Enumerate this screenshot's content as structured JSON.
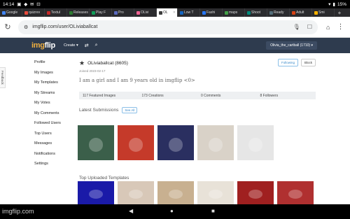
{
  "status": {
    "time": "14:14",
    "icons": "▣ ◆ ✉ ⊡",
    "battery": "15%"
  },
  "tabs": [
    {
      "label": "Google",
      "color": "#4285f4"
    },
    {
      "label": "quizrev",
      "color": "#e84b3c"
    },
    {
      "label": "Textul",
      "color": "#c62828"
    },
    {
      "label": "Releases",
      "color": "#2e7d32"
    },
    {
      "label": "Play F",
      "color": "#0f9d58"
    },
    {
      "label": "Pro",
      "color": "#5c6bc0"
    },
    {
      "label": "OLivi",
      "color": "#f06292"
    },
    {
      "label": "OL",
      "color": "#3d3d3d",
      "active": true
    },
    {
      "label": "Low T",
      "color": "#1565c0"
    },
    {
      "label": "Fashi",
      "color": "#2979ff"
    },
    {
      "label": "maps",
      "color": "#43a047"
    },
    {
      "label": "Shoot",
      "color": "#00897b"
    },
    {
      "label": "Ready",
      "color": "#546e7a"
    },
    {
      "label": "Adult",
      "color": "#d84315"
    },
    {
      "label": "Smi",
      "color": "#ffb300"
    }
  ],
  "address": {
    "url": "imgflip.com/user/OLiviaballcat"
  },
  "header": {
    "logo_a": "img",
    "logo_b": "flip",
    "create": "Create ▾",
    "username_btn": "Olivia_the_cartball (1710) ▾"
  },
  "feedback": "Feedback",
  "sidebar": {
    "items": [
      {
        "label": "Profile"
      },
      {
        "label": "My Images"
      },
      {
        "label": "My Templates"
      },
      {
        "label": "My Streams"
      },
      {
        "label": "My Votes"
      },
      {
        "label": "My Comments"
      },
      {
        "label": "Followed Users"
      },
      {
        "label": "Top Users"
      },
      {
        "label": "Messages"
      },
      {
        "label": "Notifications"
      },
      {
        "label": "Settings"
      }
    ]
  },
  "profile": {
    "username": "OLiviaballcat (8605)",
    "joined": "Joined 2023-02-17",
    "follow": "Following",
    "block": "Block",
    "bio": "I am a girl and I am 9 years old in imgflip <0>",
    "stats": [
      "117 Featured Images",
      "173 Creations",
      "0 Comments",
      "8 Followers"
    ],
    "latest_title": "Latest Submissions",
    "see_all": "See All",
    "templates_title": "Top Uploaded Templates"
  },
  "thumbs_row1": [
    "#3b5f4a",
    "#c53a2a",
    "#2a2f60",
    "#d9d2c8",
    "#e6e6e6",
    "#ffffff"
  ],
  "thumbs_row2": [
    "#1a1aa8",
    "#d8c8b8",
    "#c8b090",
    "#e8e2d8",
    "#a02020",
    "#b03030"
  ],
  "navbar": {
    "watermark": "imgflip.com"
  }
}
